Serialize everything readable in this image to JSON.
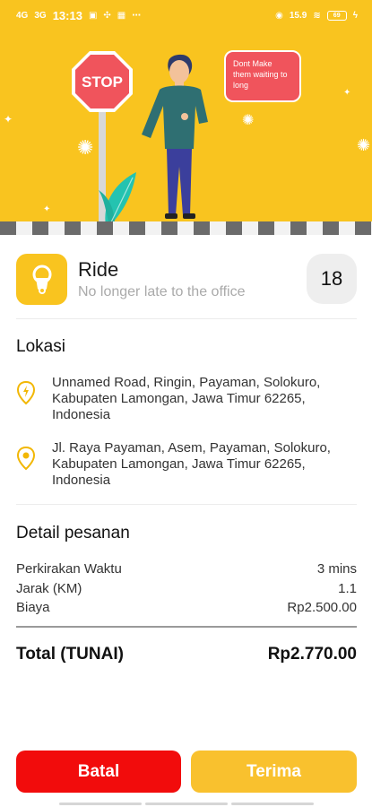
{
  "status_bar": {
    "time": "13:13",
    "left_icons": [
      "4G",
      "3G",
      "N",
      "signal-icon",
      "image-icon",
      "more-icon"
    ],
    "right_icons": [
      "location-icon",
      "speed",
      "wifi-icon"
    ],
    "speed_text": "15.9",
    "battery_level": "69"
  },
  "banner": {
    "stop_sign_text": "STOP",
    "speech_text": "Dont Make them waiting to long"
  },
  "service": {
    "title": "Ride",
    "subtitle": "No longer late to the office",
    "count": "18",
    "icon": "scooter-icon"
  },
  "location": {
    "heading": "Lokasi",
    "pickup": "Unnamed Road, Ringin, Payaman, Solokuro, Kabupaten Lamongan, Jawa Timur 62265, Indonesia",
    "destination": "Jl. Raya Payaman, Asem, Payaman, Solokuro, Kabupaten Lamongan, Jawa Timur 62265, Indonesia"
  },
  "order_details": {
    "heading": "Detail pesanan",
    "rows": [
      {
        "label": "Perkirakan Waktu",
        "value": "3 mins"
      },
      {
        "label": "Jarak (KM)",
        "value": "1.1"
      },
      {
        "label": "Biaya",
        "value": "Rp2.500.00"
      }
    ],
    "total_label": "Total (TUNAI)",
    "total_value": "Rp2.770.00"
  },
  "actions": {
    "cancel_label": "Batal",
    "accept_label": "Terima"
  },
  "colors": {
    "brand_yellow": "#f9c41f",
    "cancel_red": "#f20c0c",
    "accept_yellow": "#f9c12e"
  }
}
